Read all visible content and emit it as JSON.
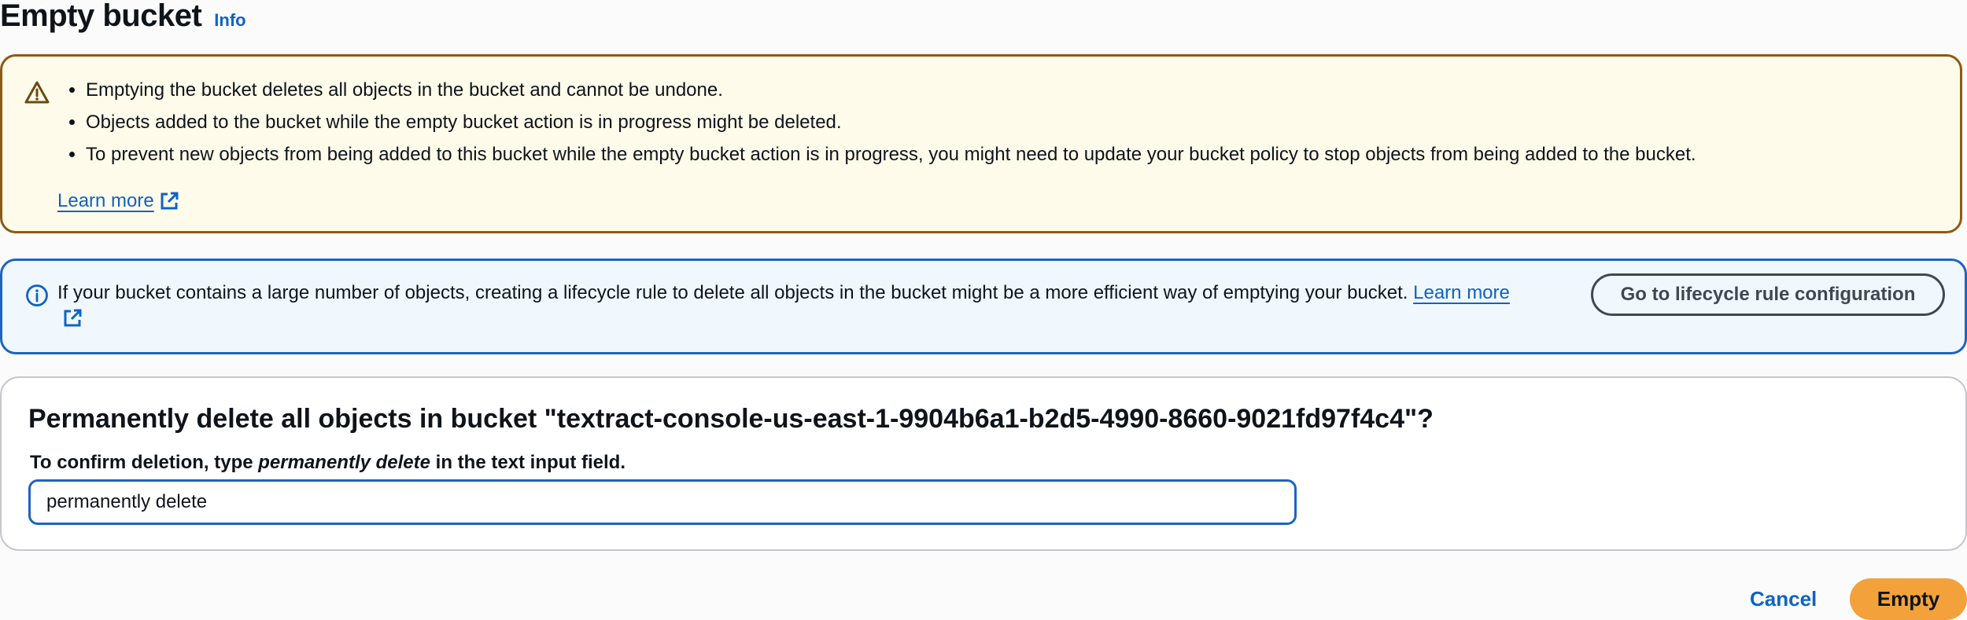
{
  "header": {
    "title": "Empty bucket",
    "info_label": "Info"
  },
  "warning": {
    "icon": "warning-icon",
    "items": [
      "Emptying the bucket deletes all objects in the bucket and cannot be undone.",
      "Objects added to the bucket while the empty bucket action is in progress might be deleted.",
      "To prevent new objects from being added to this bucket while the empty bucket action is in progress, you might need to update your bucket policy to stop objects from being added to the bucket."
    ],
    "learn_more": "Learn more"
  },
  "info_alert": {
    "icon": "info-icon",
    "text": "If your bucket contains a large number of objects, creating a lifecycle rule to delete all objects in the bucket might be a more efficient way of emptying your bucket.",
    "learn_more": "Learn more",
    "button_label": "Go to lifecycle rule configuration"
  },
  "confirm": {
    "heading": "Permanently delete all objects in bucket \"textract-console-us-east-1-9904b6a1-b2d5-4990-8660-9021fd97f4c4\"?",
    "label_prefix": "To confirm deletion, type ",
    "label_emphasis": "permanently delete",
    "label_suffix": " in the text input field.",
    "input_value": "permanently delete"
  },
  "actions": {
    "cancel_label": "Cancel",
    "empty_label": "Empty"
  },
  "colors": {
    "warning_border": "#8c5a15",
    "warning_bg": "#fffbea",
    "info_border": "#1c64c3",
    "info_bg": "#f0f8fd",
    "link": "#0f62c5",
    "primary_button": "#f3a23b"
  }
}
